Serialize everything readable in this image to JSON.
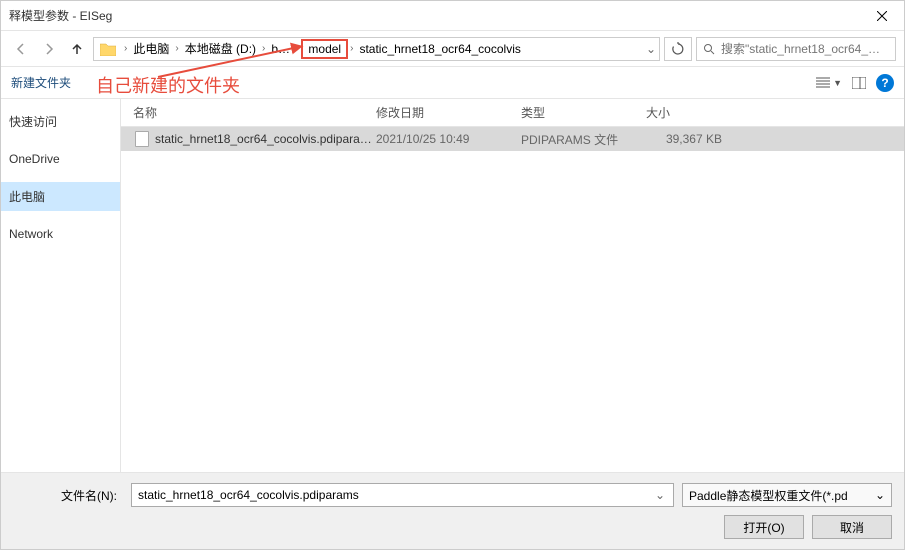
{
  "window": {
    "title": "释模型参数 - EISeg"
  },
  "nav": {
    "breadcrumbs": [
      "此电脑",
      "本地磁盘 (D:)",
      "b…",
      "model",
      "static_hrnet18_ocr64_cocolvis"
    ],
    "search_placeholder": "搜索\"static_hrnet18_ocr64_…"
  },
  "annotation": {
    "text": "自己新建的文件夹"
  },
  "toolbar": {
    "new_folder": "新建文件夹"
  },
  "sidebar": {
    "items": [
      "快速访问",
      "OneDrive",
      "此电脑",
      "Network"
    ],
    "selected_index": 2
  },
  "columns": {
    "name": "名称",
    "date": "修改日期",
    "type": "类型",
    "size": "大小"
  },
  "files": [
    {
      "name": "static_hrnet18_ocr64_cocolvis.pdipara…",
      "date": "2021/10/25 10:49",
      "type": "PDIPARAMS 文件",
      "size": "39,367 KB",
      "selected": true
    }
  ],
  "footer": {
    "filename_label": "文件名(N):",
    "filename_value": "static_hrnet18_ocr64_cocolvis.pdiparams",
    "filter": "Paddle静态模型权重文件(*.pd",
    "open": "打开(O)",
    "cancel": "取消"
  }
}
